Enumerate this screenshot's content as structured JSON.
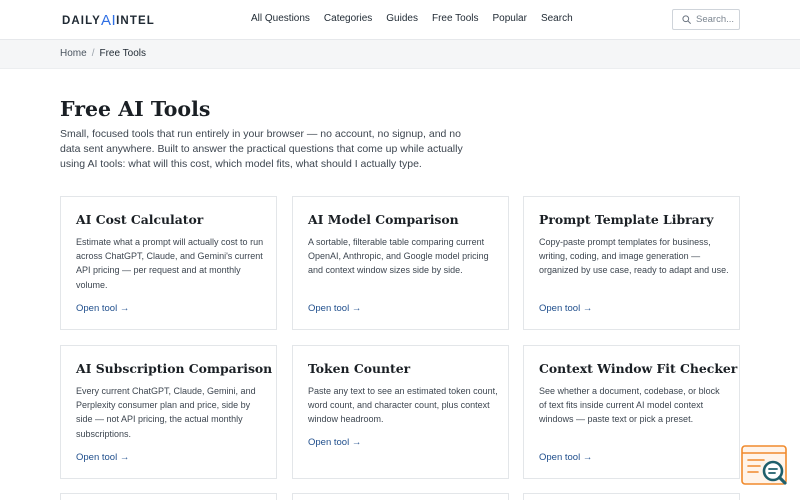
{
  "header": {
    "logo_left": "DAILY",
    "logo_ai": "AI",
    "logo_right": "INTEL",
    "nav": [
      "All Questions",
      "Categories",
      "Guides",
      "Free Tools",
      "Popular",
      "Search"
    ],
    "search_placeholder": "Search...",
    "search_icon": "search-icon"
  },
  "breadcrumb": {
    "home": "Home",
    "separator": "/",
    "current": "Free Tools"
  },
  "main": {
    "title": "Free AI Tools",
    "intro": "Small, focused tools that run entirely in your browser — no account, no signup, and no data sent anywhere. Built to answer the practical questions that come up while actually using AI tools: what will this cost, which model fits, what should I actually type."
  },
  "cards": [
    {
      "title": "AI Cost Calculator",
      "description": "Estimate what a prompt will actually cost to run across ChatGPT, Claude, and Gemini's current API pricing — per request and at monthly volume.",
      "link": "Open tool →"
    },
    {
      "title": "AI Model Comparison",
      "description": "A sortable, filterable table comparing current OpenAI, Anthropic, and Google model pricing and context window sizes side by side.",
      "link": "Open tool →"
    },
    {
      "title": "Prompt Template Library",
      "description": "Copy-paste prompt templates for business, writing, coding, and image generation — organized by use case, ready to adapt and use.",
      "link": "Open tool →"
    },
    {
      "title": "AI Subscription Comparison",
      "description": "Every current ChatGPT, Claude, Gemini, and Perplexity consumer plan and price, side by side — not API pricing, the actual monthly subscriptions.",
      "link": "Open tool →"
    },
    {
      "title": "Token Counter",
      "description": "Paste any text to see an estimated token count, word count, and character count, plus context window headroom.",
      "link": "Open tool →"
    },
    {
      "title": "Context Window Fit Checker",
      "description": "See whether a document, codebase, or block of text fits inside current AI model context windows — paste text or pick a preset.",
      "link": "Open tool →"
    }
  ],
  "colors": {
    "accent": "#2f6fe4",
    "link": "#1f4e8c",
    "widget_orange": "#f08a2c",
    "widget_teal": "#1f5f6b"
  },
  "widget": {
    "icon": "magnifier-chat-widget-icon"
  }
}
